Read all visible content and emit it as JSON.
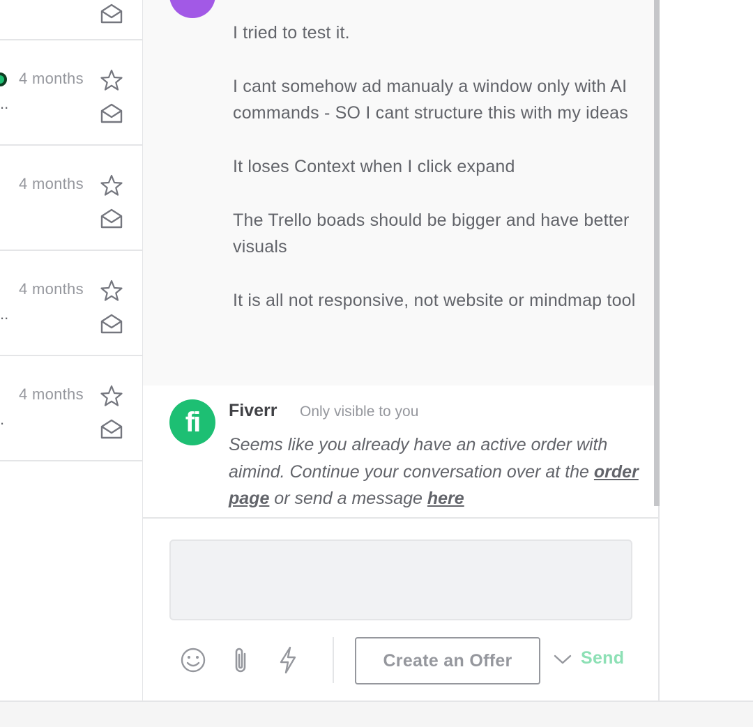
{
  "conversations": [
    {
      "time": "",
      "has_dots": false
    },
    {
      "time": "4 months",
      "has_dots": true
    },
    {
      "time": "4 months",
      "has_dots": false
    },
    {
      "time": "4 months",
      "has_dots": true
    },
    {
      "time": "4 months",
      "has_dots": true
    }
  ],
  "message_user": {
    "paragraphs": [
      "I tried to test it.",
      "I cant somehow ad manualy a window only with AI commands - SO I cant structure this with my ideas",
      "It loses Context when I click expand",
      "The Trello boads should be bigger and have better visuals",
      "It is all not responsive, not website or mindmap tool"
    ]
  },
  "message_fiverr": {
    "logo_text": "fi",
    "sender": "Fiverr",
    "visibility": "Only visible to you",
    "text_part1": "Seems like you already have an active order with aimind. Continue your conversation over at the ",
    "link1": "order page",
    "text_part2": " or send a message ",
    "link2": "here"
  },
  "composer": {
    "placeholder": ""
  },
  "actions": {
    "create_offer": "Create an Offer",
    "send": "Send"
  },
  "colors": {
    "brand_green": "#1dbf73",
    "send_disabled": "#8de0b5",
    "user_avatar": "#a259e6"
  },
  "icons": {
    "star": "star-icon",
    "envelope": "envelope-open-icon",
    "emoji": "smiley-icon",
    "attach": "paperclip-icon",
    "quick": "lightning-icon",
    "chevron": "chevron-down-icon"
  }
}
